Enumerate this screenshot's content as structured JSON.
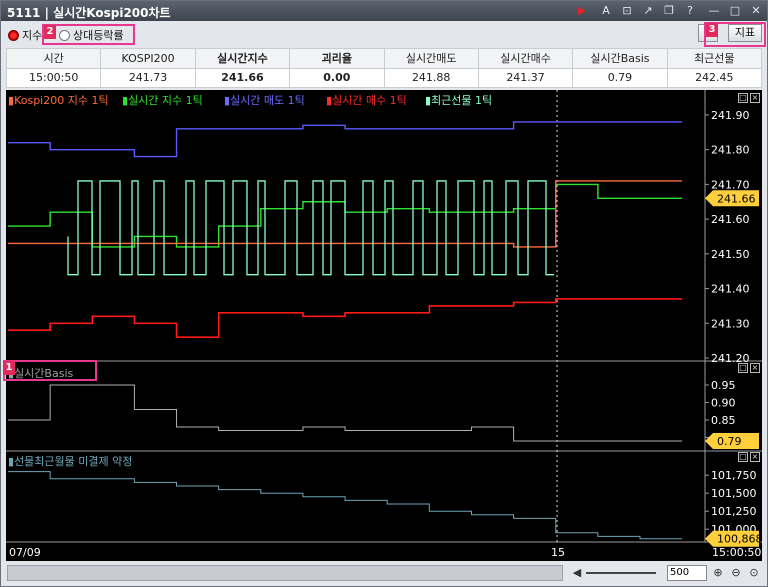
{
  "window": {
    "screen_no": "5111",
    "title": "실시간Kospi200차트"
  },
  "toolbar": {
    "radio_index": "지수",
    "radio_rate": "상대등락률",
    "right_btn_1": "D",
    "indicator_btn": "지표",
    "callout_1": "1",
    "callout_2": "2",
    "callout_3": "3"
  },
  "summary": {
    "headers": [
      "시간",
      "KOSPI200",
      "실시간지수",
      "괴리율",
      "실시간매도",
      "실시간매수",
      "실시간Basis",
      "최근선물"
    ],
    "values": [
      "15:00:50",
      "241.73",
      "241.66",
      "0.00",
      "241.88",
      "241.37",
      "0.79",
      "242.45"
    ]
  },
  "legend": {
    "kospi200": "Kospi200 지수 1틱",
    "realtime_index": "실시간 지수 1틱",
    "realtime_sell": "실시간 매도 1틱",
    "realtime_buy": "실시간 매수 1틱",
    "futures": "최근선물 1틱",
    "basis_title": "실시간Basis",
    "fut_title": "선물최근월물 미결제 약정"
  },
  "axis": {
    "main_ticks": [
      "241.90",
      "241.80",
      "241.70",
      "241.60",
      "241.50",
      "241.40",
      "241.30",
      "241.20"
    ],
    "main_badge": "241.66",
    "basis_ticks": [
      "0.95",
      "0.90",
      "0.85",
      "0.80"
    ],
    "basis_badge": "0.79",
    "oi_ticks": [
      "101,750",
      "101,500",
      "101,250",
      "101,000"
    ],
    "oi_badge": "100,868",
    "x_left": "07/09",
    "x_mid": "15",
    "x_right": "15:00:50"
  },
  "bottombar": {
    "zoom_value": "500"
  },
  "colors": {
    "kospi200": "#ff6a3d",
    "realtime_index": "#31e331",
    "realtime_sell": "#5b5bff",
    "realtime_buy": "#ff1a1a",
    "futures": "#8affc8",
    "badge": "#ffcf3c"
  },
  "chart_data": {
    "type": "line",
    "series_main": {
      "kospi200": [
        241.53,
        241.53,
        241.53,
        241.53,
        241.53,
        241.53,
        241.53,
        241.53,
        241.53,
        241.53,
        241.53,
        241.53,
        241.52,
        241.71,
        241.71,
        241.71
      ],
      "realtime_index": [
        241.58,
        241.62,
        241.52,
        241.55,
        241.52,
        241.58,
        241.63,
        241.65,
        241.62,
        241.63,
        241.62,
        241.62,
        241.63,
        241.7,
        241.66,
        241.66
      ],
      "realtime_sell": [
        241.82,
        241.8,
        241.8,
        241.78,
        241.86,
        241.86,
        241.86,
        241.87,
        241.86,
        241.86,
        241.86,
        241.86,
        241.88,
        241.88,
        241.88,
        241.88
      ],
      "realtime_buy": [
        241.28,
        241.3,
        241.32,
        241.3,
        241.26,
        241.33,
        241.33,
        241.32,
        241.33,
        241.33,
        241.35,
        241.35,
        241.36,
        241.37,
        241.37,
        241.37
      ]
    },
    "basis": [
      0.85,
      0.95,
      0.95,
      0.88,
      0.83,
      0.82,
      0.82,
      0.83,
      0.82,
      0.82,
      0.82,
      0.83,
      0.79,
      0.79,
      0.79,
      0.79
    ],
    "open_interest": [
      101800,
      101700,
      101700,
      101650,
      101600,
      101550,
      101500,
      101450,
      101400,
      101350,
      101250,
      101200,
      101150,
      100950,
      100900,
      100868
    ],
    "main_ylim": [
      241.2,
      241.92
    ],
    "basis_ylim": [
      0.77,
      0.97
    ],
    "oi_ylim": [
      100850,
      101850
    ]
  }
}
